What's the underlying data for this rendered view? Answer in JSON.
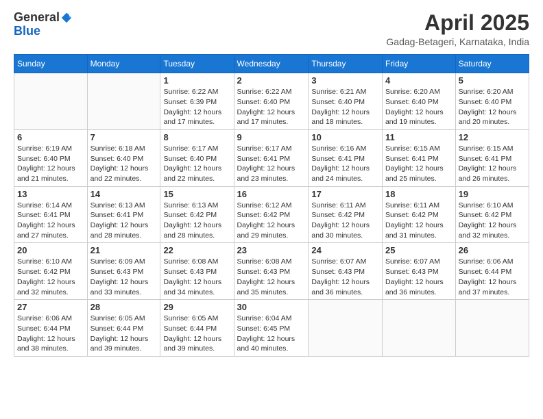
{
  "header": {
    "logo_general": "General",
    "logo_blue": "Blue",
    "month_title": "April 2025",
    "location": "Gadag-Betageri, Karnataka, India"
  },
  "days_of_week": [
    "Sunday",
    "Monday",
    "Tuesday",
    "Wednesday",
    "Thursday",
    "Friday",
    "Saturday"
  ],
  "weeks": [
    [
      {
        "day": "",
        "info": ""
      },
      {
        "day": "",
        "info": ""
      },
      {
        "day": "1",
        "info": "Sunrise: 6:22 AM\nSunset: 6:39 PM\nDaylight: 12 hours and 17 minutes."
      },
      {
        "day": "2",
        "info": "Sunrise: 6:22 AM\nSunset: 6:40 PM\nDaylight: 12 hours and 17 minutes."
      },
      {
        "day": "3",
        "info": "Sunrise: 6:21 AM\nSunset: 6:40 PM\nDaylight: 12 hours and 18 minutes."
      },
      {
        "day": "4",
        "info": "Sunrise: 6:20 AM\nSunset: 6:40 PM\nDaylight: 12 hours and 19 minutes."
      },
      {
        "day": "5",
        "info": "Sunrise: 6:20 AM\nSunset: 6:40 PM\nDaylight: 12 hours and 20 minutes."
      }
    ],
    [
      {
        "day": "6",
        "info": "Sunrise: 6:19 AM\nSunset: 6:40 PM\nDaylight: 12 hours and 21 minutes."
      },
      {
        "day": "7",
        "info": "Sunrise: 6:18 AM\nSunset: 6:40 PM\nDaylight: 12 hours and 22 minutes."
      },
      {
        "day": "8",
        "info": "Sunrise: 6:17 AM\nSunset: 6:40 PM\nDaylight: 12 hours and 22 minutes."
      },
      {
        "day": "9",
        "info": "Sunrise: 6:17 AM\nSunset: 6:41 PM\nDaylight: 12 hours and 23 minutes."
      },
      {
        "day": "10",
        "info": "Sunrise: 6:16 AM\nSunset: 6:41 PM\nDaylight: 12 hours and 24 minutes."
      },
      {
        "day": "11",
        "info": "Sunrise: 6:15 AM\nSunset: 6:41 PM\nDaylight: 12 hours and 25 minutes."
      },
      {
        "day": "12",
        "info": "Sunrise: 6:15 AM\nSunset: 6:41 PM\nDaylight: 12 hours and 26 minutes."
      }
    ],
    [
      {
        "day": "13",
        "info": "Sunrise: 6:14 AM\nSunset: 6:41 PM\nDaylight: 12 hours and 27 minutes."
      },
      {
        "day": "14",
        "info": "Sunrise: 6:13 AM\nSunset: 6:41 PM\nDaylight: 12 hours and 28 minutes."
      },
      {
        "day": "15",
        "info": "Sunrise: 6:13 AM\nSunset: 6:42 PM\nDaylight: 12 hours and 28 minutes."
      },
      {
        "day": "16",
        "info": "Sunrise: 6:12 AM\nSunset: 6:42 PM\nDaylight: 12 hours and 29 minutes."
      },
      {
        "day": "17",
        "info": "Sunrise: 6:11 AM\nSunset: 6:42 PM\nDaylight: 12 hours and 30 minutes."
      },
      {
        "day": "18",
        "info": "Sunrise: 6:11 AM\nSunset: 6:42 PM\nDaylight: 12 hours and 31 minutes."
      },
      {
        "day": "19",
        "info": "Sunrise: 6:10 AM\nSunset: 6:42 PM\nDaylight: 12 hours and 32 minutes."
      }
    ],
    [
      {
        "day": "20",
        "info": "Sunrise: 6:10 AM\nSunset: 6:42 PM\nDaylight: 12 hours and 32 minutes."
      },
      {
        "day": "21",
        "info": "Sunrise: 6:09 AM\nSunset: 6:43 PM\nDaylight: 12 hours and 33 minutes."
      },
      {
        "day": "22",
        "info": "Sunrise: 6:08 AM\nSunset: 6:43 PM\nDaylight: 12 hours and 34 minutes."
      },
      {
        "day": "23",
        "info": "Sunrise: 6:08 AM\nSunset: 6:43 PM\nDaylight: 12 hours and 35 minutes."
      },
      {
        "day": "24",
        "info": "Sunrise: 6:07 AM\nSunset: 6:43 PM\nDaylight: 12 hours and 36 minutes."
      },
      {
        "day": "25",
        "info": "Sunrise: 6:07 AM\nSunset: 6:43 PM\nDaylight: 12 hours and 36 minutes."
      },
      {
        "day": "26",
        "info": "Sunrise: 6:06 AM\nSunset: 6:44 PM\nDaylight: 12 hours and 37 minutes."
      }
    ],
    [
      {
        "day": "27",
        "info": "Sunrise: 6:06 AM\nSunset: 6:44 PM\nDaylight: 12 hours and 38 minutes."
      },
      {
        "day": "28",
        "info": "Sunrise: 6:05 AM\nSunset: 6:44 PM\nDaylight: 12 hours and 39 minutes."
      },
      {
        "day": "29",
        "info": "Sunrise: 6:05 AM\nSunset: 6:44 PM\nDaylight: 12 hours and 39 minutes."
      },
      {
        "day": "30",
        "info": "Sunrise: 6:04 AM\nSunset: 6:45 PM\nDaylight: 12 hours and 40 minutes."
      },
      {
        "day": "",
        "info": ""
      },
      {
        "day": "",
        "info": ""
      },
      {
        "day": "",
        "info": ""
      }
    ]
  ]
}
